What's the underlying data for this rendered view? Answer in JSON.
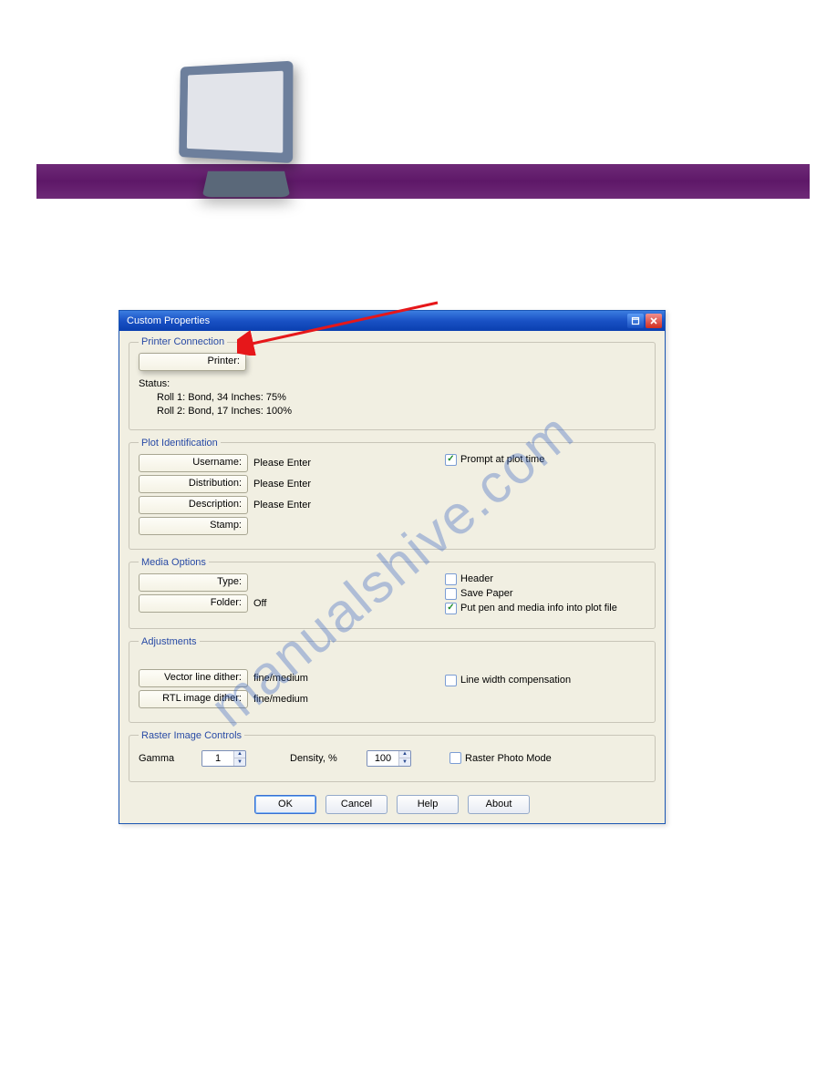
{
  "watermark": "manualshive.com",
  "dialog": {
    "title": "Custom Properties",
    "printer_connection": {
      "legend": "Printer Connection",
      "printer_btn": "Printer:",
      "status_label": "Status:",
      "roll1": "Roll 1: Bond, 34 Inches: 75%",
      "roll2": "Roll 2: Bond, 17 Inches: 100%"
    },
    "plot_id": {
      "legend": "Plot Identification",
      "username_btn": "Username:",
      "username_val": "Please Enter",
      "distribution_btn": "Distribution:",
      "distribution_val": "Please Enter",
      "description_btn": "Description:",
      "description_val": "Please Enter",
      "stamp_btn": "Stamp:",
      "prompt_label": "Prompt at plot time"
    },
    "media": {
      "legend": "Media Options",
      "type_btn": "Type:",
      "folder_btn": "Folder:",
      "folder_val": "Off",
      "header_label": "Header",
      "savepaper_label": "Save Paper",
      "putpen_label": "Put pen and media info into plot file"
    },
    "adjustments": {
      "legend": "Adjustments",
      "vector_btn": "Vector line dither:",
      "vector_val": "fine/medium",
      "rtl_btn": "RTL image dither:",
      "rtl_val": "fine/medium",
      "linewidth_label": "Line width compensation"
    },
    "raster": {
      "legend": "Raster Image Controls",
      "gamma_label": "Gamma",
      "gamma_value": "1",
      "density_label": "Density, %",
      "density_value": "100",
      "photomode_label": "Raster Photo Mode"
    },
    "buttons": {
      "ok": "OK",
      "cancel": "Cancel",
      "help": "Help",
      "about": "About"
    }
  }
}
